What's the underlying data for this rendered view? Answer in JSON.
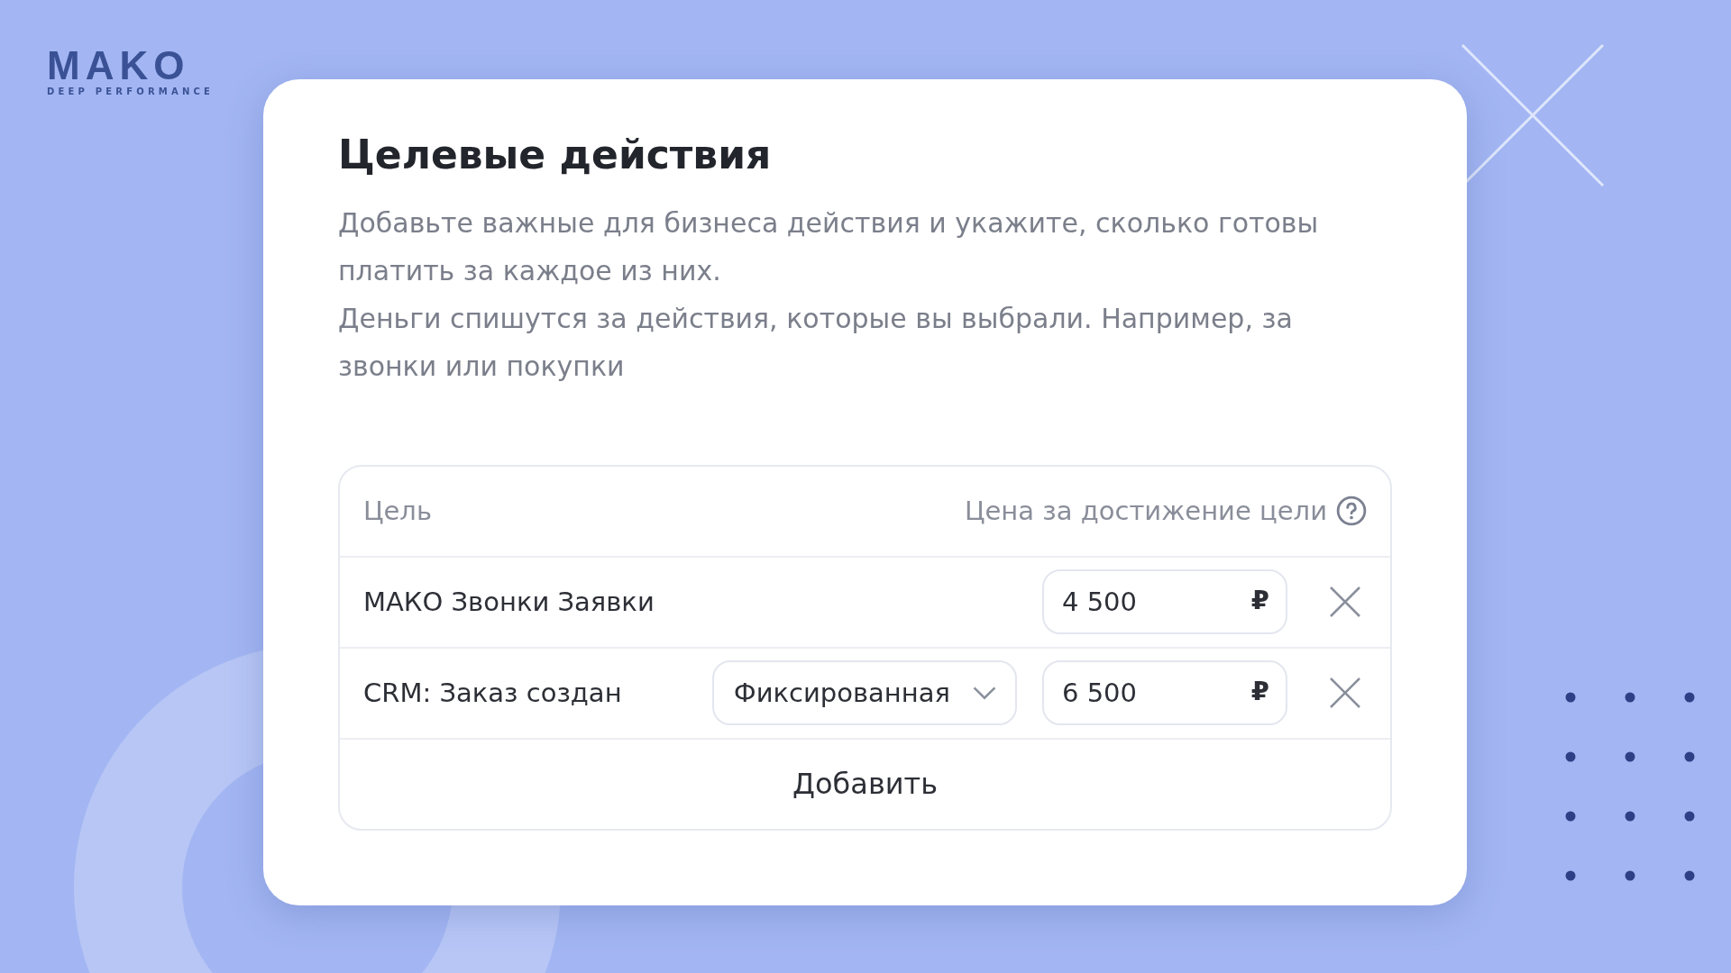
{
  "logo": {
    "wordmark": "MAKO",
    "tagline": "DEEP PERFORMANCE"
  },
  "dialog": {
    "title": "Целевые действия",
    "description": [
      "Добавьте важные для бизнеса действия и укажите, сколько готовы платить за каждое из них.",
      "Деньги спишутся за действия, которые вы выбрали. Например, за звонки или покупки"
    ],
    "table": {
      "columns": [
        "Цель",
        "Цена за достижение цели"
      ],
      "rows": [
        {
          "goal": "МАКО Звонки Заявки",
          "price": "4 500",
          "currency": "₽"
        },
        {
          "goal": "CRM: Заказ создан",
          "mode": "Фиксированная",
          "price": "6 500",
          "currency": "₽"
        }
      ],
      "add_button": "Добавить"
    }
  }
}
